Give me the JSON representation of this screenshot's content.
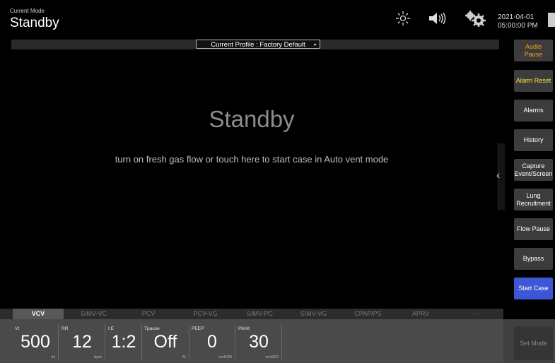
{
  "header": {
    "mode_label": "Current Mode",
    "mode_value": "Standby",
    "icons": [
      "brightness-icon",
      "volume-icon",
      "settings-icon",
      "battery-icon"
    ],
    "date": "2021-04-01",
    "time": "05:00:00 PM"
  },
  "profile": {
    "label": "Current Profile : Factory Default",
    "arrow": "▸"
  },
  "main": {
    "title": "Standby",
    "hint": "turn on fresh gas flow or touch here to start case in Auto vent mode",
    "collapse_chevron": "‹"
  },
  "side_buttons": [
    {
      "label": "Audio Pause",
      "color": "#ff9a1f"
    },
    {
      "label": "Alarm Reset",
      "color": "#ffe24a"
    },
    {
      "label": "Alarms"
    },
    {
      "label": "History"
    },
    {
      "label": "Capture Event/Screen"
    },
    {
      "label": "Lung Recruitment"
    },
    {
      "label": "Flow Pause"
    },
    {
      "label": "Bypass"
    },
    {
      "label": "Start Case",
      "color": "#3d56d6"
    }
  ],
  "mode_tabs": [
    "VCV",
    "SIMV-VC",
    "PCV",
    "PCV-VG",
    "SIMV-PC",
    "SIMV-VG",
    "CPAP/PS",
    "APRV",
    "···"
  ],
  "active_tab": "VCV",
  "params": [
    {
      "label": "Vt",
      "value": "500",
      "unit": "ml"
    },
    {
      "label": "RR",
      "value": "12",
      "unit": "bpm"
    },
    {
      "label": "I:E",
      "value": "1:2",
      "unit": ""
    },
    {
      "label": "Tpause",
      "value": "Off",
      "unit": "%"
    },
    {
      "label": "PEEP",
      "value": "0",
      "unit": "cmH2O"
    },
    {
      "label": "Plimit",
      "value": "30",
      "unit": "cmH2O"
    }
  ],
  "set_mode_label": "Set Mode"
}
